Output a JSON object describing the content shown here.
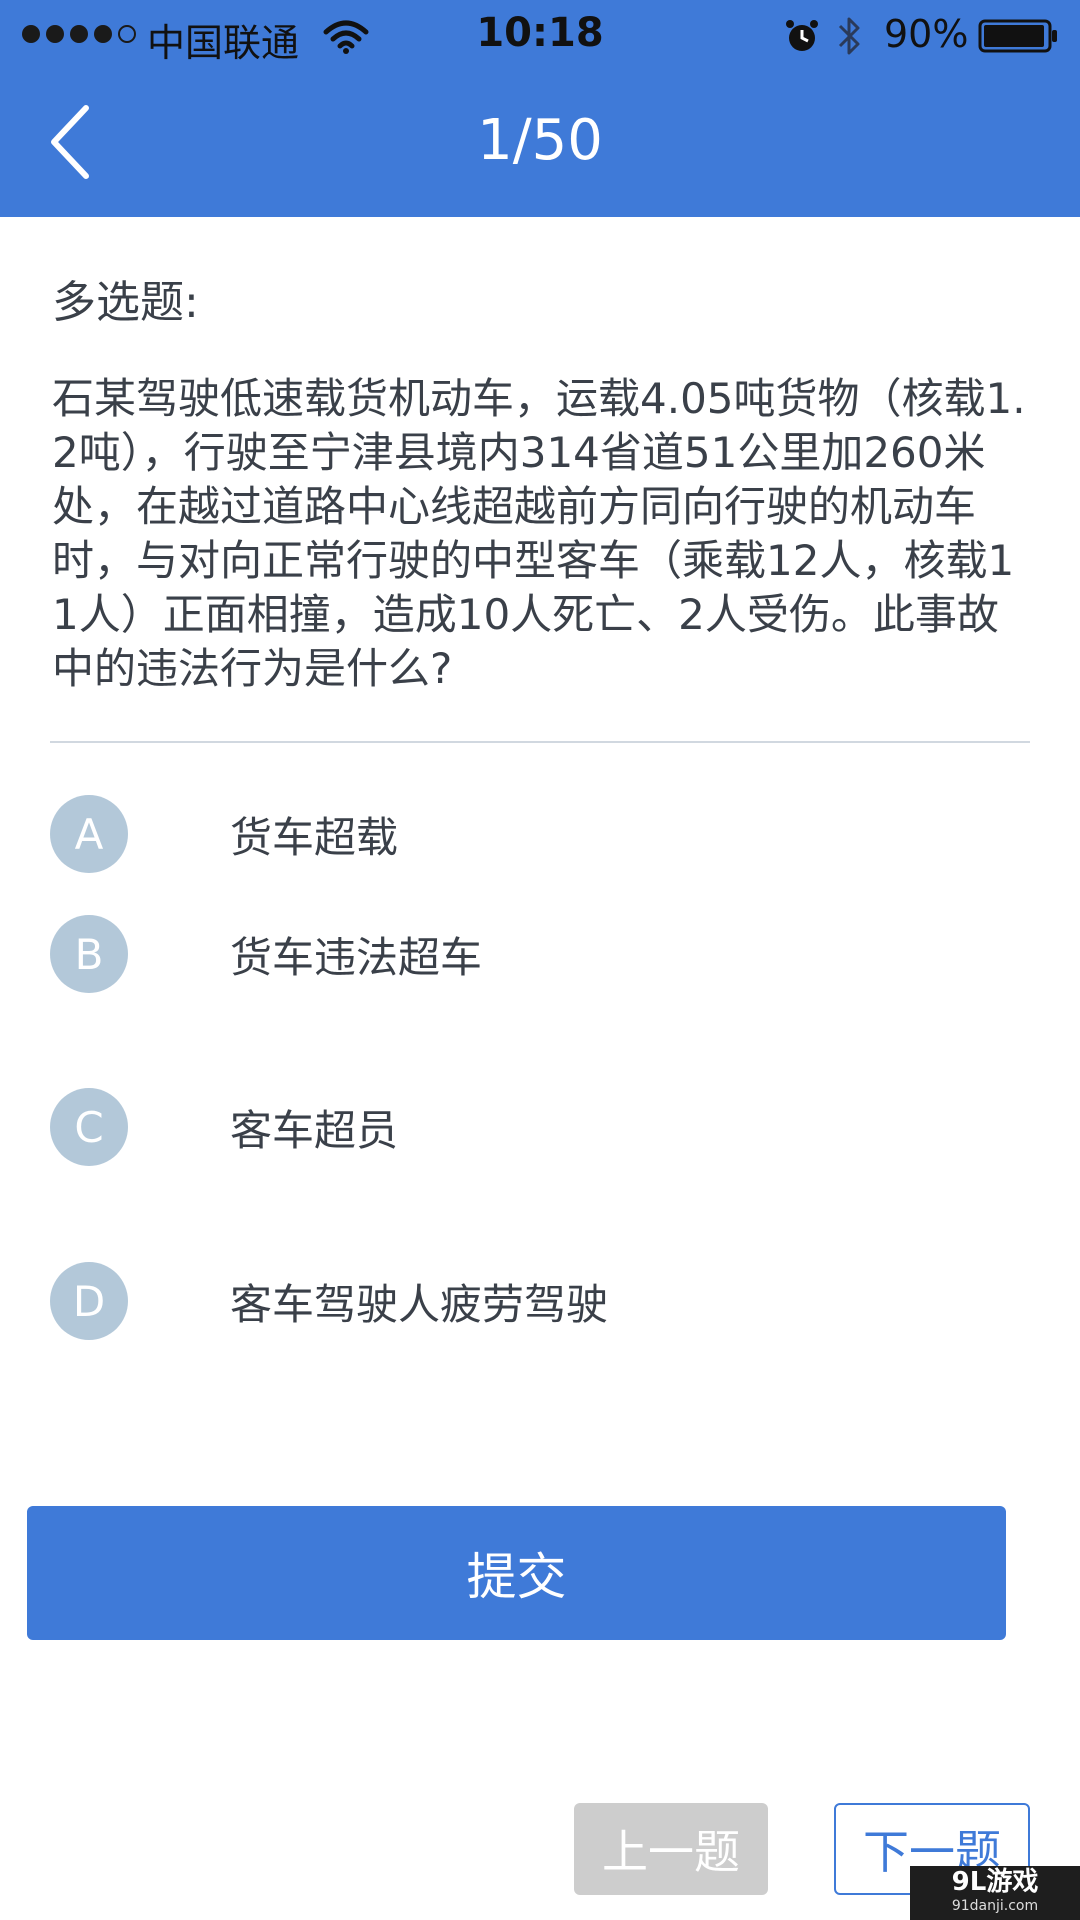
{
  "status_bar": {
    "carrier": "中国联通",
    "time": "10:18",
    "battery": "90%"
  },
  "nav": {
    "title": "1/50"
  },
  "question": {
    "type": "多选题:",
    "text": "石某驾驶低速载货机动车，运载4.05吨货物（核载1.2吨），行驶至宁津县境内314省道51公里加260米处，在越过道路中心线超越前方同向行驶的机动车时，与对向正常行驶的中型客车（乘载12人，核载11人）正面相撞，造成10人死亡、2人受伤。此事故中的违法行为是什么?"
  },
  "options": [
    {
      "letter": "A",
      "label": "货车超载"
    },
    {
      "letter": "B",
      "label": "货车违法超车"
    },
    {
      "letter": "C",
      "label": "客车超员"
    },
    {
      "letter": "D",
      "label": "客车驾驶人疲劳驾驶"
    }
  ],
  "buttons": {
    "submit": "提交",
    "prev": "上一题",
    "next": "下一题"
  },
  "watermark": {
    "main": "9L游戏",
    "sub": "91danji.com"
  },
  "colors": {
    "primary": "#3f7ad8",
    "badge": "#b3c8d9",
    "disabled": "#cdcdcd",
    "text": "#3a4049"
  },
  "icons": {
    "back": "chevron-left-icon",
    "wifi": "wifi-icon",
    "alarm": "alarm-icon",
    "bluetooth": "bluetooth-icon",
    "battery": "battery-icon"
  }
}
